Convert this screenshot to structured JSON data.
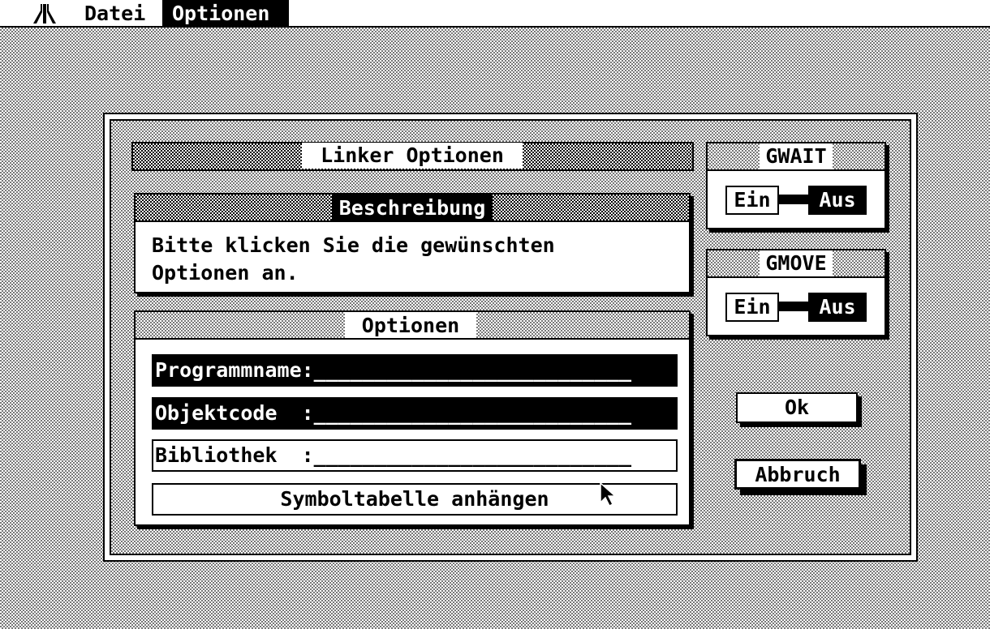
{
  "menubar": {
    "logo_icon": "atari-fuji-icon",
    "items": [
      {
        "label": "Datei",
        "selected": false
      },
      {
        "label": "Optionen",
        "selected": true
      }
    ]
  },
  "dialog": {
    "title": "Linker Optionen",
    "description": {
      "header": "Beschreibung",
      "text": "Bitte klicken Sie die gewünschten\nOptionen an."
    },
    "options": {
      "header": "Optionen",
      "fields": [
        {
          "label": "Programmname:",
          "value": "__________________________",
          "selected": true
        },
        {
          "label": "Objektcode  :",
          "value": "__________________________",
          "selected": true
        },
        {
          "label": "Bibliothek  :",
          "value": "__________________________",
          "selected": false
        }
      ],
      "symbol_button": "Symboltabelle anhängen"
    },
    "toggles": [
      {
        "title": "GWAIT",
        "on_label": "Ein",
        "off_label": "Aus",
        "selected": "Aus"
      },
      {
        "title": "GMOVE",
        "on_label": "Ein",
        "off_label": "Aus",
        "selected": "Aus"
      }
    ],
    "buttons": {
      "ok": "Ok",
      "cancel": "Abbruch"
    }
  },
  "colors": {
    "foreground": "#000000",
    "background": "#ffffff"
  },
  "cursor_icon": "arrow-pointer-icon"
}
